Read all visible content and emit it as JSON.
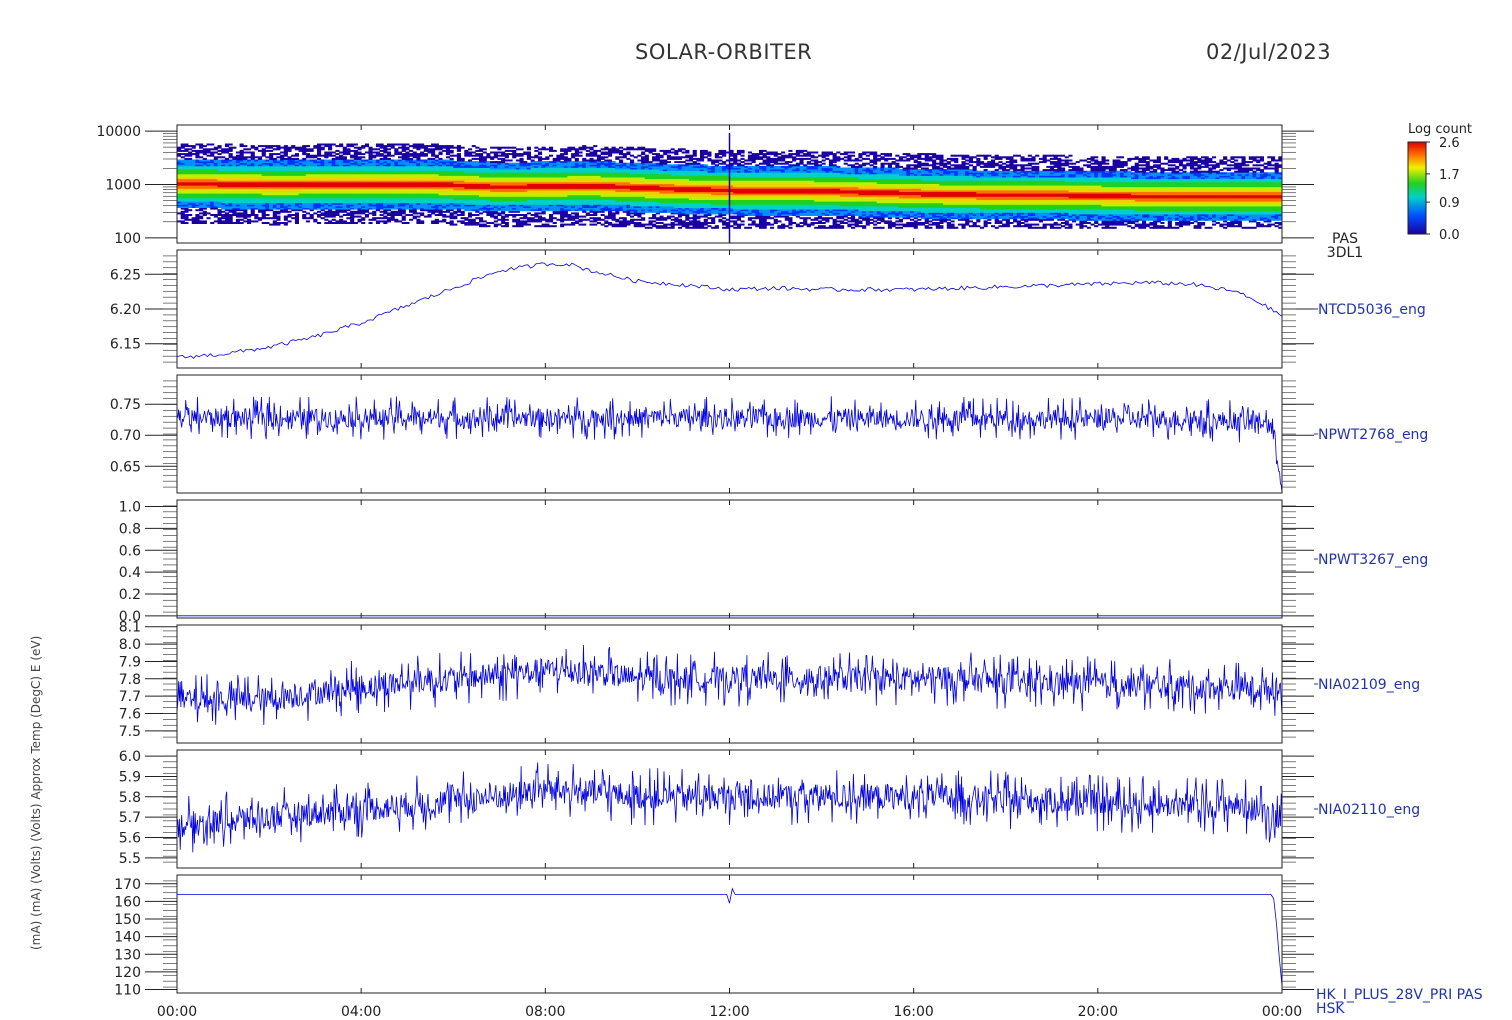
{
  "header": {
    "mission": "SOLAR-ORBITER",
    "date": "02/Jul/2023"
  },
  "chart_data": {
    "type": "line",
    "x_ticks": [
      "00:00",
      "04:00",
      "08:00",
      "12:00",
      "16:00",
      "20:00",
      "00:00"
    ],
    "x_range_hours": [
      0,
      24
    ],
    "ylabels": "(mA)  (mA)  (Volts)  (Volts)  Approx Temp (DegC)  E (eV)",
    "panels": [
      {
        "kind": "spectrogram",
        "label_lines": [
          "PAS",
          "3DL1"
        ],
        "y_scale": "log",
        "y_ticks": [
          "10000",
          "1000",
          "100"
        ],
        "y_tick_values": [
          10000,
          1000,
          100
        ],
        "y_range": [
          80,
          13000
        ],
        "colorbar": {
          "title": "Log count",
          "ticks": [
            "2.6",
            "1.7",
            "0.9",
            "0.0"
          ],
          "tick_values": [
            2.6,
            1.7,
            0.9,
            0.0
          ],
          "range": [
            0.0,
            2.6
          ]
        },
        "core_energy_eV": [
          [
            0,
            1050
          ],
          [
            2,
            1000
          ],
          [
            5.5,
            1020
          ],
          [
            7,
            900
          ],
          [
            9,
            950
          ],
          [
            11,
            820
          ],
          [
            12,
            780
          ],
          [
            14,
            760
          ],
          [
            15.5,
            700
          ],
          [
            17,
            650
          ],
          [
            19,
            640
          ],
          [
            21,
            600
          ],
          [
            24,
            600
          ]
        ]
      },
      {
        "kind": "line",
        "label": "NTCD5036_eng",
        "y_ticks": [
          "6.25",
          "6.20",
          "6.15"
        ],
        "y_tick_values": [
          6.25,
          6.2,
          6.15
        ],
        "y_range": [
          6.115,
          6.285
        ],
        "x": [
          0,
          1,
          2,
          3,
          4,
          5,
          6,
          7,
          8,
          8.5,
          9,
          10,
          11,
          12,
          13,
          14,
          15,
          16,
          17,
          18,
          19,
          20,
          21,
          22,
          23,
          23.5,
          24
        ],
        "y": [
          6.13,
          6.135,
          6.145,
          6.16,
          6.18,
          6.205,
          6.23,
          6.255,
          6.265,
          6.265,
          6.255,
          6.24,
          6.235,
          6.228,
          6.23,
          6.228,
          6.228,
          6.228,
          6.23,
          6.232,
          6.234,
          6.236,
          6.238,
          6.236,
          6.225,
          6.21,
          6.19
        ]
      },
      {
        "kind": "line",
        "label": "NPWT2768_eng",
        "y_ticks": [
          "0.75",
          "0.70",
          "0.65"
        ],
        "y_tick_values": [
          0.75,
          0.7,
          0.65
        ],
        "y_range": [
          0.607,
          0.797
        ],
        "x": [
          0,
          12,
          22,
          23,
          23.7,
          23.85,
          24
        ],
        "y": [
          0.728,
          0.728,
          0.726,
          0.722,
          0.722,
          0.69,
          0.62
        ],
        "noise_amplitude": 0.022
      },
      {
        "kind": "line",
        "label": "NPWT3267_eng",
        "y_ticks": [
          "1.0",
          "0.8",
          "0.6",
          "0.4",
          "0.2",
          "0.0"
        ],
        "y_tick_values": [
          1.0,
          0.8,
          0.6,
          0.4,
          0.2,
          0.0
        ],
        "y_range": [
          -0.02,
          1.06
        ],
        "x": [
          0,
          24
        ],
        "y": [
          0.0,
          0.0
        ]
      },
      {
        "kind": "line",
        "label": "NIA02109_eng",
        "y_ticks": [
          "8.1",
          "8.0",
          "7.9",
          "7.8",
          "7.7",
          "7.6",
          "7.5"
        ],
        "y_tick_values": [
          8.1,
          8.0,
          7.9,
          7.8,
          7.7,
          7.6,
          7.5
        ],
        "y_range": [
          7.43,
          8.11
        ],
        "x": [
          0,
          1,
          2,
          3,
          4,
          5,
          6,
          7,
          8,
          9,
          10,
          11,
          12,
          13,
          14,
          15,
          16,
          17,
          18,
          19,
          20,
          21,
          22,
          23,
          24
        ],
        "y": [
          7.67,
          7.68,
          7.68,
          7.72,
          7.75,
          7.78,
          7.8,
          7.82,
          7.85,
          7.84,
          7.8,
          7.8,
          7.8,
          7.8,
          7.8,
          7.8,
          7.8,
          7.8,
          7.78,
          7.78,
          7.77,
          7.76,
          7.75,
          7.75,
          7.74
        ],
        "noise_amplitude": 0.1
      },
      {
        "kind": "line",
        "label": "NIA02110_eng",
        "y_ticks": [
          "6.0",
          "5.9",
          "5.8",
          "5.7",
          "5.6",
          "5.5"
        ],
        "y_tick_values": [
          6.0,
          5.9,
          5.8,
          5.7,
          5.6,
          5.5
        ],
        "y_range": [
          5.45,
          6.03
        ],
        "x": [
          0,
          1,
          2,
          3,
          4,
          5,
          6,
          7,
          8,
          9,
          10,
          11,
          12,
          13,
          14,
          15,
          16,
          17,
          18,
          19,
          20,
          21,
          22,
          23,
          24
        ],
        "y": [
          5.66,
          5.68,
          5.7,
          5.72,
          5.74,
          5.76,
          5.78,
          5.8,
          5.84,
          5.82,
          5.8,
          5.8,
          5.8,
          5.8,
          5.8,
          5.8,
          5.8,
          5.8,
          5.78,
          5.78,
          5.77,
          5.76,
          5.76,
          5.76,
          5.7
        ],
        "noise_amplitude": 0.09
      },
      {
        "kind": "line",
        "label_lines": [
          "HK_I_PLUS_28V_PRI PAS",
          "HSK"
        ],
        "y_ticks": [
          "170",
          "160",
          "150",
          "140",
          "130",
          "120",
          "110"
        ],
        "y_tick_values": [
          170,
          160,
          150,
          140,
          130,
          120,
          110
        ],
        "y_range": [
          108,
          175
        ],
        "x": [
          0,
          11.95,
          12.0,
          12.05,
          12.1,
          23.8,
          23.85,
          23.9,
          24
        ],
        "y": [
          164,
          164,
          159,
          168,
          164,
          164,
          158,
          140,
          112
        ]
      }
    ]
  }
}
